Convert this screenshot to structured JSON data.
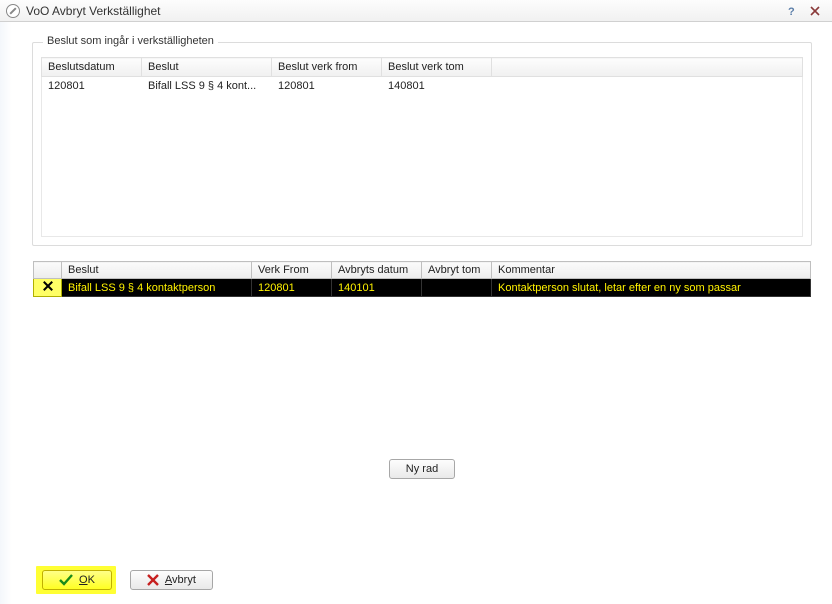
{
  "window": {
    "title": "VoO Avbryt Verkställighet"
  },
  "group1": {
    "legend": "Beslut som ingår i verkställigheten",
    "columns": {
      "c0": "Beslutsdatum",
      "c1": "Beslut",
      "c2": "Beslut verk from",
      "c3": "Beslut verk tom"
    },
    "row0": {
      "c0": "120801",
      "c1": "Bifall LSS 9 § 4 kont...",
      "c2": "120801",
      "c3": "140801"
    }
  },
  "grid2": {
    "columns": {
      "c0": "Beslut",
      "c1": "Verk From",
      "c2": "Avbryts datum",
      "c3": "Avbryt tom",
      "c4": "Kommentar"
    },
    "row0": {
      "c0": "Bifall LSS 9 § 4 kontaktperson",
      "c1": "120801",
      "c2": "140101",
      "c3": "",
      "c4": "Kontaktperson slutat, letar efter en ny som passar"
    }
  },
  "buttons": {
    "nyrad": "Ny rad",
    "ok": "OK",
    "avbryt": "Avbryt"
  }
}
